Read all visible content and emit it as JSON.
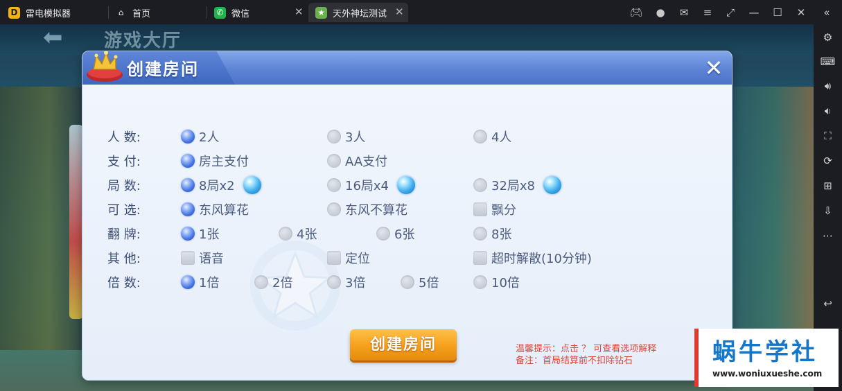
{
  "window": {
    "tabs": [
      {
        "label": "雷电模拟器"
      },
      {
        "label": "首页"
      },
      {
        "label": "微信"
      },
      {
        "label": "天外神坛测试"
      }
    ]
  },
  "game": {
    "lobby_title": "游戏大厅",
    "back_icon": "back-arrow-icon"
  },
  "dialog": {
    "title": "创建房间",
    "rows": [
      {
        "label": "人 数:",
        "options": [
          {
            "text": "2人",
            "checked": true
          },
          {
            "text": "3人",
            "checked": false
          },
          {
            "text": "4人",
            "checked": false
          }
        ]
      },
      {
        "label": "支 付:",
        "options": [
          {
            "text": "房主支付",
            "checked": true
          },
          {
            "text": "AA支付",
            "checked": false
          }
        ]
      },
      {
        "label": "局 数:",
        "options": [
          {
            "text": "8局x2",
            "checked": true
          },
          {
            "text": "16局x4",
            "checked": false
          },
          {
            "text": "32局x8",
            "checked": false
          }
        ]
      },
      {
        "label": "可 选:",
        "options": [
          {
            "text": "东风算花",
            "checked": true
          },
          {
            "text": "东风不算花",
            "checked": false
          },
          {
            "text": "飘分",
            "checked": false
          }
        ]
      },
      {
        "label": "翻 牌:",
        "options": [
          {
            "text": "1张",
            "checked": true
          },
          {
            "text": "4张",
            "checked": false
          },
          {
            "text": "6张",
            "checked": false
          },
          {
            "text": "8张",
            "checked": false
          }
        ]
      },
      {
        "label": "其 他:",
        "options": [
          {
            "text": "语音",
            "checked": false
          },
          {
            "text": "定位",
            "checked": false
          },
          {
            "text": "超时解散(10分钟)",
            "checked": false
          }
        ]
      },
      {
        "label": "倍 数:",
        "options": [
          {
            "text": "1倍",
            "checked": true
          },
          {
            "text": "2倍",
            "checked": false
          },
          {
            "text": "3倍",
            "checked": false
          },
          {
            "text": "5倍",
            "checked": false
          },
          {
            "text": "10倍",
            "checked": false
          }
        ]
      }
    ],
    "create_button": "创建房间",
    "hint_line1": "温馨提示：点击 ？ 可查看选项解释",
    "hint_line2": "备注：首局结算前不扣除钻石"
  },
  "brand": {
    "title": "蜗牛学社",
    "url": "www.woniuxueshe.com"
  },
  "colors": {
    "dialog_header": "#5d83d6",
    "radio_on": "#3f6fe0",
    "button_orange": "#f7a21e",
    "hint_red": "#e0453a",
    "brand_blue": "#1577c9"
  }
}
